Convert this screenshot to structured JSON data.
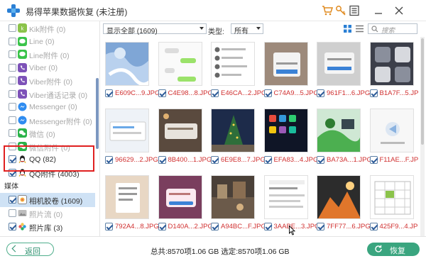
{
  "app": {
    "title": "易得苹果数据恢复 (未注册)"
  },
  "sidebar": {
    "items": [
      {
        "label": "Kik附件 (0)",
        "checked": false,
        "dim": true,
        "icon": "kik-icon",
        "color": "#8bc34a"
      },
      {
        "label": "Line (0)",
        "checked": false,
        "dim": true,
        "icon": "line-icon",
        "color": "#3ac34a"
      },
      {
        "label": "Line附件 (0)",
        "checked": false,
        "dim": true,
        "icon": "line-icon",
        "color": "#3ac34a"
      },
      {
        "label": "Viber (0)",
        "checked": false,
        "dim": true,
        "icon": "viber-icon",
        "color": "#7d52b8"
      },
      {
        "label": "Viber附件 (0)",
        "checked": false,
        "dim": true,
        "icon": "viber-icon",
        "color": "#7d52b8"
      },
      {
        "label": "Viber通话记录 (0)",
        "checked": false,
        "dim": true,
        "icon": "viber-icon",
        "color": "#7d52b8"
      },
      {
        "label": "Messenger (0)",
        "checked": false,
        "dim": true,
        "icon": "messenger-icon",
        "color": "#2f8cf0"
      },
      {
        "label": "Messenger附件 (0)",
        "checked": false,
        "dim": true,
        "icon": "messenger-icon",
        "color": "#2f8cf0"
      },
      {
        "label": "微信 (0)",
        "checked": false,
        "dim": true,
        "icon": "wechat-icon",
        "color": "#2bb34a"
      },
      {
        "label": "微信附件 (0)",
        "checked": false,
        "dim": true,
        "icon": "wechat-icon",
        "color": "#2bb34a"
      },
      {
        "label": "QQ (82)",
        "checked": true,
        "dim": false,
        "icon": "qq-icon",
        "color": "#222222"
      },
      {
        "label": "QQ附件 (4003)",
        "checked": true,
        "dim": false,
        "icon": "qq-icon",
        "color": "#222222"
      }
    ],
    "section_media": "媒体",
    "media_items": [
      {
        "label": "相机胶卷 (1609)",
        "checked": true,
        "dim": false,
        "selected": true,
        "icon": "camera-roll-icon"
      },
      {
        "label": "照片流 (0)",
        "checked": false,
        "dim": true,
        "selected": false,
        "icon": "photo-stream-icon"
      },
      {
        "label": "照片库 (3)",
        "checked": true,
        "dim": false,
        "selected": false,
        "icon": "photo-library-icon"
      }
    ]
  },
  "toolbar": {
    "filter_value": "显示全部 (1609)",
    "type_label": "类型:",
    "type_value": "所有",
    "search_placeholder": "搜索"
  },
  "grid": {
    "items": [
      {
        "name": "E609C...9.JPG"
      },
      {
        "name": "C4E98...8.JPG"
      },
      {
        "name": "E46CA...2.JPG"
      },
      {
        "name": "C74A9...5.JPG"
      },
      {
        "name": "961F1...6.JPG"
      },
      {
        "name": "B1A7F...5.JPG"
      },
      {
        "name": "96629...2.JPG"
      },
      {
        "name": "8B400...1.JPG"
      },
      {
        "name": "6E9E8...7.JPG"
      },
      {
        "name": "EFA83...4.JPG"
      },
      {
        "name": "BA73A...1.JPG"
      },
      {
        "name": "F11AE...F.JPG"
      },
      {
        "name": "792A4...8.JPG"
      },
      {
        "name": "D140A...2.JPG"
      },
      {
        "name": "A94BC...F.JPG"
      },
      {
        "name": "3AABE...3.JPG"
      },
      {
        "name": "7FF77...6.JPG"
      },
      {
        "name": "425F9...4.JPG"
      }
    ]
  },
  "footer": {
    "back_label": "返回",
    "stats": "总共:8570项1.06 GB 选定:8570项1.06 GB",
    "recover_label": "恢复"
  }
}
